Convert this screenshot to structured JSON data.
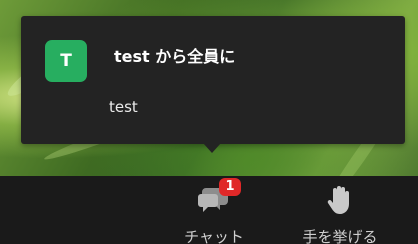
{
  "notification": {
    "avatar_letter": "T",
    "avatar_color": "#27ae60",
    "sender_line": "test から全員に",
    "message": "test"
  },
  "toolbar": {
    "chat": {
      "label": "チャット",
      "icon": "chat-bubbles-icon",
      "badge_count": "1"
    },
    "raise_hand": {
      "label": "手を挙げる",
      "icon": "raise-hand-icon"
    }
  },
  "colors": {
    "popover_bg": "#232323",
    "toolbar_bg": "#1a1a1a",
    "badge_red": "#e02828"
  }
}
